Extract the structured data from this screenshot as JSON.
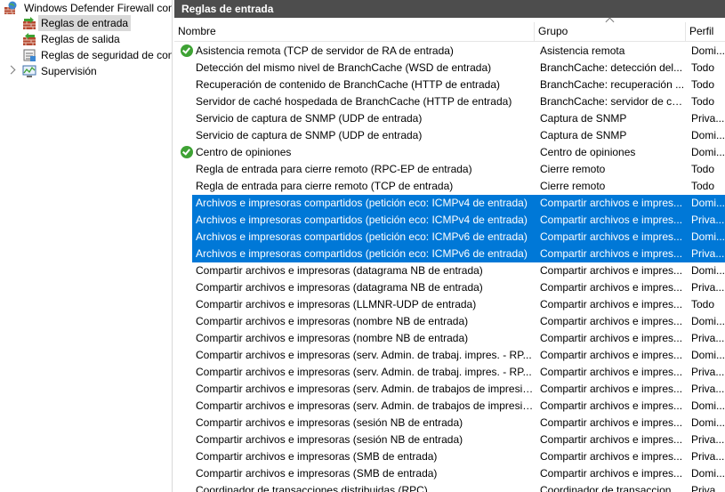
{
  "tree": {
    "items": [
      {
        "label": "Windows Defender Firewall con"
      },
      {
        "label": "Reglas de entrada"
      },
      {
        "label": "Reglas de salida"
      },
      {
        "label": "Reglas de seguridad de con"
      },
      {
        "label": "Supervisión"
      }
    ]
  },
  "main": {
    "title": "Reglas de entrada",
    "columns": {
      "name": "Nombre",
      "group": "Grupo",
      "profile": "Perfil"
    },
    "rows": [
      {
        "name": "Asistencia remota (TCP de servidor de RA de entrada)",
        "group": "Asistencia remota",
        "profile": "Domi...",
        "enabled": true
      },
      {
        "name": "Detección del mismo nivel de BranchCache (WSD de entrada)",
        "group": "BranchCache: detección del...",
        "profile": "Todo"
      },
      {
        "name": "Recuperación de contenido de BranchCache (HTTP de entrada)",
        "group": "BranchCache: recuperación ...",
        "profile": "Todo"
      },
      {
        "name": "Servidor de caché hospedada de BranchCache (HTTP de entrada)",
        "group": "BranchCache: servidor de ca...",
        "profile": "Todo"
      },
      {
        "name": "Servicio de captura de SNMP (UDP de entrada)",
        "group": "Captura de SNMP",
        "profile": "Priva..."
      },
      {
        "name": "Servicio de captura de SNMP (UDP de entrada)",
        "group": "Captura de SNMP",
        "profile": "Domi..."
      },
      {
        "name": "Centro de opiniones",
        "group": "Centro de opiniones",
        "profile": "Domi...",
        "enabled": true
      },
      {
        "name": "Regla de entrada para cierre remoto (RPC-EP de entrada)",
        "group": "Cierre remoto",
        "profile": "Todo"
      },
      {
        "name": "Regla de entrada para cierre remoto (TCP de entrada)",
        "group": "Cierre remoto",
        "profile": "Todo"
      },
      {
        "name": "Archivos e impresoras compartidos (petición eco: ICMPv4 de entrada)",
        "group": "Compartir archivos e impres...",
        "profile": "Domi...",
        "selected": true
      },
      {
        "name": "Archivos e impresoras compartidos (petición eco: ICMPv4 de entrada)",
        "group": "Compartir archivos e impres...",
        "profile": "Priva...",
        "selected": true
      },
      {
        "name": "Archivos e impresoras compartidos (petición eco: ICMPv6 de entrada)",
        "group": "Compartir archivos e impres...",
        "profile": "Domi...",
        "selected": true
      },
      {
        "name": "Archivos e impresoras compartidos (petición eco: ICMPv6 de entrada)",
        "group": "Compartir archivos e impres...",
        "profile": "Priva...",
        "selected": true
      },
      {
        "name": "Compartir archivos e impresoras (datagrama NB de entrada)",
        "group": "Compartir archivos e impres...",
        "profile": "Domi..."
      },
      {
        "name": "Compartir archivos e impresoras (datagrama NB de entrada)",
        "group": "Compartir archivos e impres...",
        "profile": "Priva..."
      },
      {
        "name": "Compartir archivos e impresoras (LLMNR-UDP de entrada)",
        "group": "Compartir archivos e impres...",
        "profile": "Todo"
      },
      {
        "name": "Compartir archivos e impresoras (nombre NB de entrada)",
        "group": "Compartir archivos e impres...",
        "profile": "Domi..."
      },
      {
        "name": "Compartir archivos e impresoras (nombre NB de entrada)",
        "group": "Compartir archivos e impres...",
        "profile": "Priva..."
      },
      {
        "name": "Compartir archivos e impresoras (serv. Admin. de trabaj. impres. - RP...",
        "group": "Compartir archivos e impres...",
        "profile": "Domi..."
      },
      {
        "name": "Compartir archivos e impresoras (serv. Admin. de trabaj. impres. - RP...",
        "group": "Compartir archivos e impres...",
        "profile": "Priva..."
      },
      {
        "name": "Compartir archivos e impresoras (serv. Admin. de trabajos de impresió...",
        "group": "Compartir archivos e impres...",
        "profile": "Priva..."
      },
      {
        "name": "Compartir archivos e impresoras (serv. Admin. de trabajos de impresió...",
        "group": "Compartir archivos e impres...",
        "profile": "Domi..."
      },
      {
        "name": "Compartir archivos e impresoras (sesión NB de entrada)",
        "group": "Compartir archivos e impres...",
        "profile": "Domi..."
      },
      {
        "name": "Compartir archivos e impresoras (sesión NB de entrada)",
        "group": "Compartir archivos e impres...",
        "profile": "Priva..."
      },
      {
        "name": "Compartir archivos e impresoras (SMB de entrada)",
        "group": "Compartir archivos e impres...",
        "profile": "Priva..."
      },
      {
        "name": "Compartir archivos e impresoras (SMB de entrada)",
        "group": "Compartir archivos e impres...",
        "profile": "Domi..."
      },
      {
        "name": "Coordinador de transacciones distribuidas (RPC)",
        "group": "Coordinador de transaccion...",
        "profile": "Priva..."
      }
    ]
  },
  "colors": {
    "selection": "#0078d7",
    "title_bar": "#4d4d4d",
    "enabled_check": "#3ea234"
  }
}
